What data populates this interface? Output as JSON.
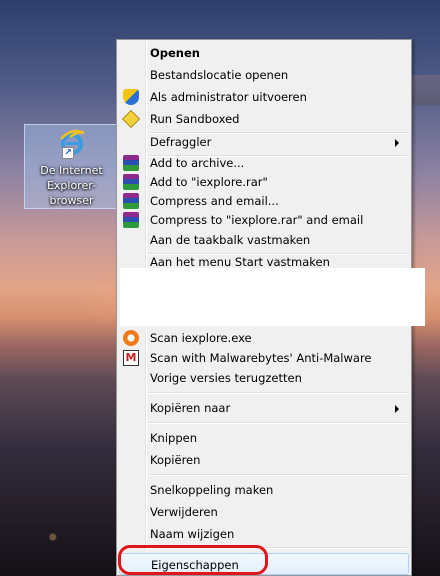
{
  "desktop": {
    "icon_label": "De Internet\nExplorer-browser\nstarten"
  },
  "menu": {
    "items": [
      {
        "label": "Openen",
        "bold": true
      },
      {
        "label": "Bestandslocatie openen"
      },
      {
        "label": "Als administrator uitvoeren",
        "icon": "uac-shield-icon"
      },
      {
        "label": "Run Sandboxed",
        "icon": "sandboxie-icon"
      },
      {
        "label": "Defraggler",
        "submenu": true
      },
      {
        "label": "Add to archive...",
        "icon": "winrar-icon"
      },
      {
        "label": "Add to \"iexplore.rar\"",
        "icon": "winrar-icon"
      },
      {
        "label": "Compress and email...",
        "icon": "winrar-icon"
      },
      {
        "label": "Compress to \"iexplore.rar\" and email",
        "icon": "winrar-icon"
      },
      {
        "label": "Aan de taakbalk vastmaken"
      },
      {
        "label": "Aan het menu Start vastmaken"
      },
      {
        "label": "Scan iexplore.exe",
        "icon": "avast-icon"
      },
      {
        "label": "Scan with Malwarebytes' Anti-Malware",
        "icon": "malwarebytes-icon"
      },
      {
        "label": "Vorige versies terugzetten"
      },
      {
        "label": "Kopiëren naar",
        "submenu": true
      },
      {
        "label": "Knippen"
      },
      {
        "label": "Kopiëren"
      },
      {
        "label": "Snelkoppeling maken"
      },
      {
        "label": "Verwijderen"
      },
      {
        "label": "Naam wijzigen"
      },
      {
        "label": "Eigenschappen",
        "highlighted": true
      }
    ]
  },
  "colors": {
    "menu_bg": "#f0f0f0",
    "highlight_border": "#aecff7",
    "annotation": "#e0151b"
  }
}
